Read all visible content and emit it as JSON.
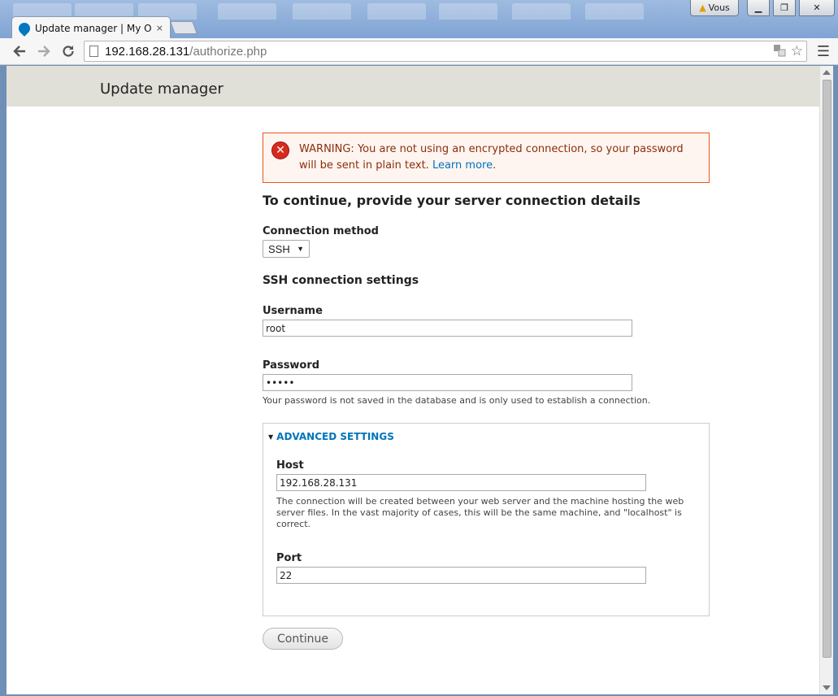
{
  "browser": {
    "tab_title": "Update manager | My Own",
    "tab_close": "×",
    "url_host": "192.168.28.131",
    "url_path": "/authorize.php",
    "user_badge": "Vous",
    "icons": {
      "back": "arrow-left-icon",
      "forward": "arrow-right-icon",
      "reload": "reload-icon",
      "star": "star-icon",
      "menu": "hamburger-icon",
      "translate": "translate-icon"
    }
  },
  "header": {
    "title": "Update manager"
  },
  "warning": {
    "text": "WARNING: You are not using an encrypted connection, so your password will be sent in plain text.",
    "link": "Learn more",
    "tail": "."
  },
  "form": {
    "heading": "To continue, provide your server connection details",
    "connection_method_label": "Connection method",
    "connection_method_value": "SSH",
    "ssh_heading": "SSH connection settings",
    "username_label": "Username",
    "username_value": "root",
    "password_label": "Password",
    "password_value": "•••••",
    "password_desc": "Your password is not saved in the database and is only used to establish a connection.",
    "advanced": {
      "legend": "ADVANCED SETTINGS",
      "host_label": "Host",
      "host_value": "192.168.28.131",
      "host_desc": "The connection will be created between your web server and the machine hosting the web server files. In the vast majority of cases, this will be the same machine, and \"localhost\" is correct.",
      "port_label": "Port",
      "port_value": "22"
    },
    "continue_label": "Continue"
  },
  "colors": {
    "warning_border": "#ed541d",
    "warning_bg": "#fef5f1",
    "link": "#0074bd",
    "header_bg": "#e0e0d8"
  }
}
